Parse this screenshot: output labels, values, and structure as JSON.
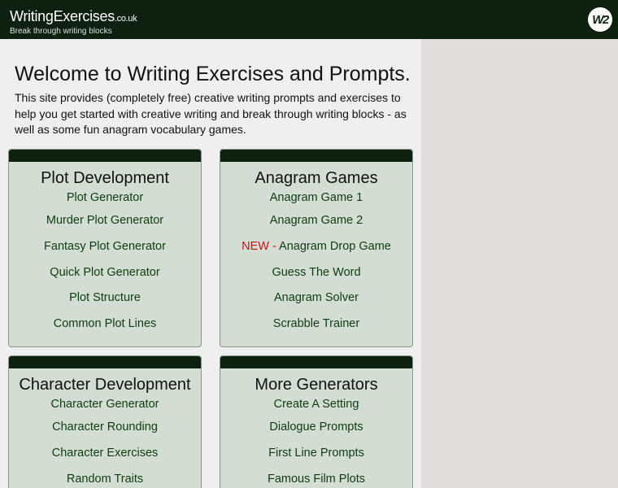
{
  "header": {
    "site_name": "WritingExercises",
    "site_tld": ".co.uk",
    "tagline": "Break through writing blocks",
    "badge_text": "W2"
  },
  "main": {
    "title": "Welcome to Writing Exercises and Prompts.",
    "intro": "This site provides (completely free) creative writing prompts and exercises to help you get started with creative writing and break through writing blocks - as well as some fun anagram vocabulary games."
  },
  "cards": {
    "plot": {
      "title": "Plot Development",
      "items": [
        "Plot Generator",
        "Murder Plot Generator",
        "Fantasy Plot Generator",
        "Quick Plot Generator",
        "Plot Structure",
        "Common Plot Lines"
      ]
    },
    "anagram": {
      "title": "Anagram Games",
      "items": [
        "Anagram Game 1",
        "Anagram Game 2",
        "Anagram Drop Game",
        "Guess The Word",
        "Anagram Solver",
        "Scrabble Trainer"
      ],
      "new_label": "NEW -"
    },
    "character": {
      "title": "Character Development",
      "items": [
        "Character Generator",
        "Character Rounding",
        "Character Exercises",
        "Random Traits"
      ]
    },
    "more": {
      "title": "More Generators",
      "items": [
        "Create A Setting",
        "Dialogue Prompts",
        "First Line Prompts",
        "Famous Film Plots"
      ]
    }
  },
  "colors": {
    "header_bg": "#0e2010",
    "card_bg": "#d3ddd3",
    "link": "#0d3d10",
    "new_badge": "#cc1111",
    "sidebar_bg": "#e0dcdc"
  }
}
